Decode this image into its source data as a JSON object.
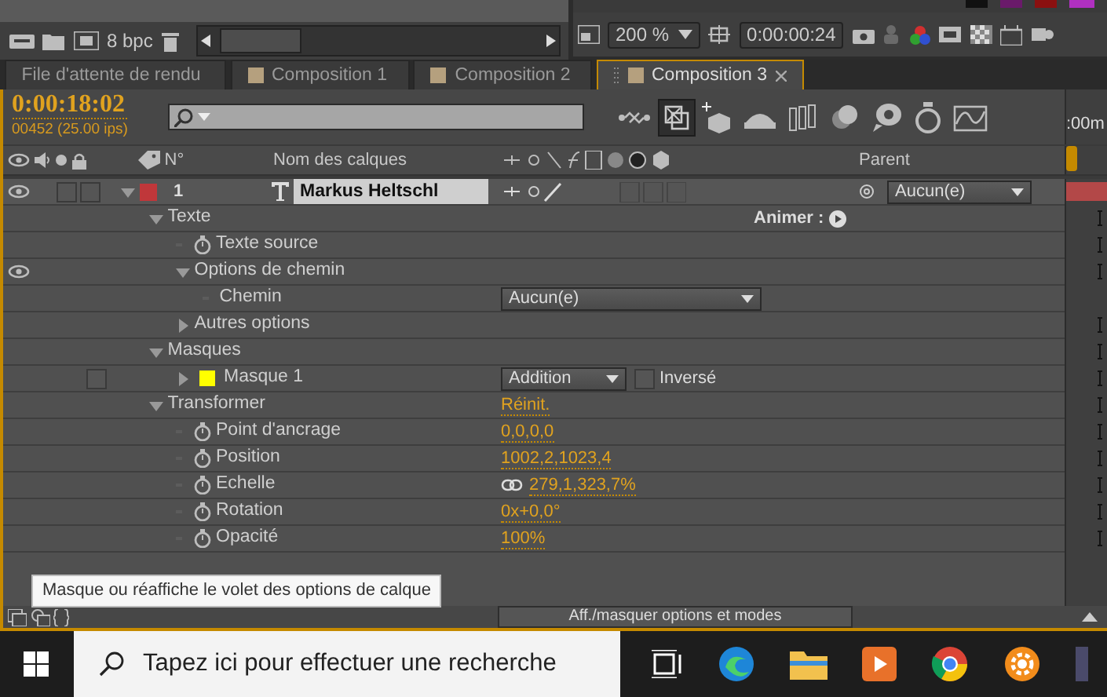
{
  "top": {
    "bit_depth": "8 bpc",
    "zoom": "200 %",
    "timecode": "0:00:00:24"
  },
  "tabs": [
    {
      "label": "File d'attente de rendu",
      "kind": "queue",
      "selected": false
    },
    {
      "label": "Composition 1",
      "kind": "comp",
      "selected": false
    },
    {
      "label": "Composition 2",
      "kind": "comp",
      "selected": false
    },
    {
      "label": "Composition 3",
      "kind": "comp",
      "selected": true
    }
  ],
  "timeline": {
    "current_time": "0:00:18:02",
    "frame_info": "00452 (25.00 ips)",
    "ruler_label": ":00m",
    "tools": [
      {
        "selected": false
      },
      {
        "selected": true
      },
      {
        "selected": false
      },
      {
        "selected": false
      },
      {
        "selected": false
      },
      {
        "selected": false
      },
      {
        "selected": false
      },
      {
        "selected": false
      },
      {
        "selected": false
      }
    ],
    "columns": {
      "number": "N°",
      "name": "Nom des calques",
      "parent": "Parent"
    },
    "layer": {
      "number": "1",
      "name": "Markus Heltschl",
      "color": "#c0373a",
      "visible": true,
      "expanded": true,
      "parent": "Aucun(e)",
      "properties": [
        {
          "label": "Texte",
          "kind": "group",
          "expanded": true,
          "visible": false,
          "action": "Animer :",
          "children": [
            {
              "label": "Texte source",
              "kind": "stopwatch",
              "visible": false
            },
            {
              "label": "Options de chemin",
              "kind": "group",
              "expanded": true,
              "visible": true,
              "children": [
                {
                  "label": "Chemin",
                  "kind": "dropdown",
                  "visible": false,
                  "value": "Aucun(e)"
                }
              ]
            },
            {
              "label": "Autres options",
              "kind": "group",
              "expanded": false,
              "visible": false
            }
          ]
        },
        {
          "label": "Masques",
          "kind": "group",
          "expanded": true,
          "visible": false,
          "children": [
            {
              "label": "Masque 1",
              "kind": "mask",
              "expanded": false,
              "visible": false,
              "color": "#ffff00",
              "mode": "Addition",
              "inverted_label": "Inversé",
              "inverted": false
            }
          ]
        },
        {
          "label": "Transformer",
          "kind": "group",
          "expanded": true,
          "visible": false,
          "value": "Réinit.",
          "children": [
            {
              "label": "Point d'ancrage",
              "kind": "stopwatch",
              "visible": false,
              "value": "0,0,0,0"
            },
            {
              "label": "Position",
              "kind": "stopwatch",
              "visible": false,
              "value": "1002,2,1023,4"
            },
            {
              "label": "Echelle",
              "kind": "linked",
              "visible": false,
              "value": "279,1,323,7%"
            },
            {
              "label": "Rotation",
              "kind": "stopwatch",
              "visible": false,
              "value": "0x+0,0°"
            },
            {
              "label": "Opacité",
              "kind": "stopwatch",
              "visible": false,
              "value": "100%"
            }
          ]
        }
      ]
    }
  },
  "tooltip": "Masque ou réaffiche le volet des options de calque",
  "bottom_button": "Aff./masquer options et modes",
  "taskbar": {
    "search_placeholder": "Tapez ici pour effectuer une recherche"
  }
}
